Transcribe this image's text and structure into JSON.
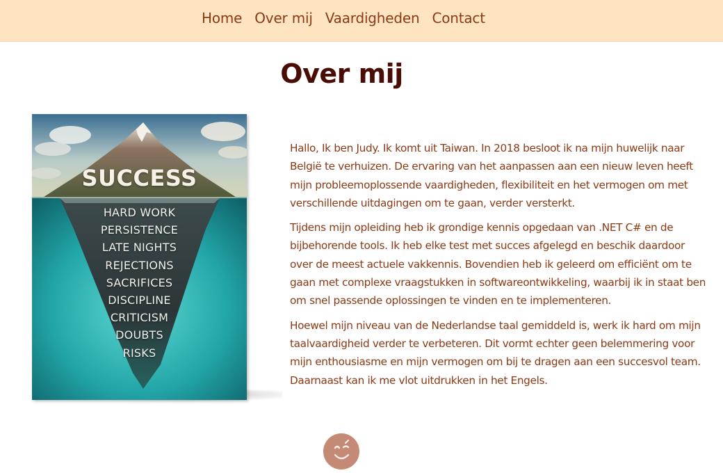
{
  "nav": {
    "items": [
      {
        "label": "Home"
      },
      {
        "label": "Over mij"
      },
      {
        "label": "Vaardigheden"
      },
      {
        "label": "Contact"
      }
    ]
  },
  "page": {
    "title": "Over mij"
  },
  "poster": {
    "heading": "SUCCESS",
    "items": [
      "HARD WORK",
      "PERSISTENCE",
      "LATE NIGHTS",
      "REJECTIONS",
      "SACRIFICES",
      "DISCIPLINE",
      "CRITICISM",
      "DOUBTS",
      "RISKS"
    ]
  },
  "about": {
    "paragraphs": [
      "Hallo, Ik ben Judy. Ik komt uit Taiwan. In 2018 besloot ik na mijn huwelijk naar België te verhuizen. De ervaring van het aanpassen aan een nieuw leven heeft mijn probleemoplossende vaardigheden, flexibiliteit en het vermogen om met verschillende uitdagingen om te gaan, verder versterkt.",
      "Tijdens mijn opleiding heb ik grondige kennis opgedaan van .NET C# en de bijbehorende tools. Ik heb elke test met succes afgelegd en beschik daardoor over de meest actuele vakkennis. Bovendien heb ik geleerd om efficiënt om te gaan met complexe vraagstukken in softwareontwikkeling, waarbij ik in staat ben om snel passende oplossingen te vinden en te implementeren.",
      "Hoewel mijn niveau van de Nederlandse taal gemiddeld is, werk ik hard om mijn taalvaardigheid verder te verbeteren. Dit vormt echter geen belemmering voor mijn enthousiasme en mijn vermogen om bij te dragen aan een succesvol team. Daarnaast kan ik me vlot uitdrukken in het Engels."
    ]
  },
  "footer": {
    "icon": "wink-face-icon"
  },
  "colors": {
    "nav_background": "#ffe4c2",
    "text": "#8b3a15",
    "title": "#4a0d05",
    "wink_badge": "#c48a76"
  }
}
